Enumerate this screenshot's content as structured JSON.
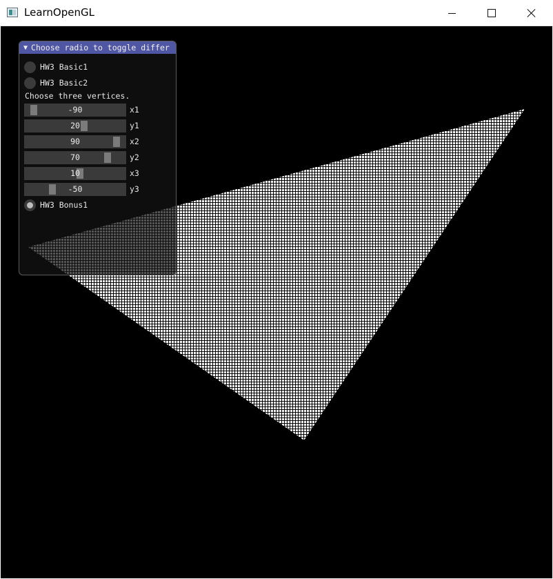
{
  "window": {
    "title": "LearnOpenGL"
  },
  "panel": {
    "title": "Choose radio to toggle differ",
    "radios": [
      {
        "label": "HW3 Basic1",
        "selected": false
      },
      {
        "label": "HW3 Basic2",
        "selected": false
      }
    ],
    "vertices_label": "Choose three vertices.",
    "sliders": [
      {
        "label": "x1",
        "value": "-90",
        "fraction": 0.05
      },
      {
        "label": "y1",
        "value": "20",
        "fraction": 0.6
      },
      {
        "label": "x2",
        "value": "90",
        "fraction": 0.95
      },
      {
        "label": "y2",
        "value": "70",
        "fraction": 0.85
      },
      {
        "label": "x3",
        "value": "10",
        "fraction": 0.55
      },
      {
        "label": "y3",
        "value": "-50",
        "fraction": 0.25
      }
    ],
    "bonus_radio": {
      "label": "HW3 Bonus1",
      "selected": true
    }
  },
  "render": {
    "background": "#000000",
    "fill_color": "#ffffff",
    "grid_color": "#000000",
    "triangle": {
      "description_values": "rasterized triangle of vertices (x1,y1),(x2,y2),(x3,y3) in a -100..100 coordinate space"
    }
  }
}
